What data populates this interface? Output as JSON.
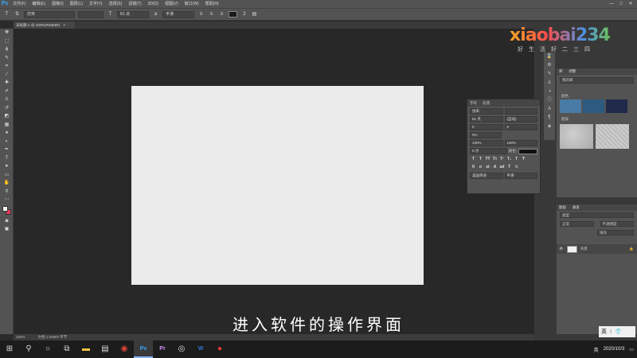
{
  "menubar": {
    "logo": "Ps",
    "items": [
      "文件(F)",
      "编辑(E)",
      "图像(I)",
      "图层(L)",
      "文字(Y)",
      "选择(S)",
      "滤镜(T)",
      "3D(D)",
      "视图(V)",
      "窗口(W)",
      "帮助(H)"
    ],
    "win_min": "—",
    "win_max": "□",
    "win_close": "✕"
  },
  "options": {
    "tool_icon": "T",
    "font_family": "仿宋",
    "font_size": "81 点",
    "aa": "平滑"
  },
  "document": {
    "tab_title": "未标题-1 @ 100%(RGB/8#)",
    "tab_close": "×",
    "zoom": "100%",
    "doc_info": "文档:1.53M/0 字节"
  },
  "right": {
    "lib_tabs": [
      "库",
      "调整"
    ],
    "lib_select": "我的库",
    "color_label": "颜色",
    "pattern_label": "图案",
    "colors": [
      "#4a7aa6",
      "#2d5a80",
      "#202a4a"
    ],
    "layer_tabs": [
      "图层",
      "通道"
    ],
    "layer_kind": "类型",
    "layer_mode": "正常",
    "layer_opacity": "不透明度",
    "layer_fill": "填充",
    "layer_name": "背景"
  },
  "char": {
    "tabs": [
      "字符",
      "段落"
    ],
    "font": "仿宋",
    "size": "81 点",
    "leading": "(自动)",
    "kerning": "0",
    "tracking": "0",
    "vscale_value": "0%",
    "hscale": "100%",
    "vscale": "100%",
    "baseline": "0 点",
    "color_label": "颜色:",
    "lang": "美国英语",
    "aa": "平滑"
  },
  "watermark": {
    "logo": "xiaobai234",
    "sub": "好生活好二三四"
  },
  "subtitle": "进入软件的操作界面",
  "taskbar": {
    "ime": "英",
    "clock_date": "2020/10/3",
    "tray_lang": "英"
  }
}
